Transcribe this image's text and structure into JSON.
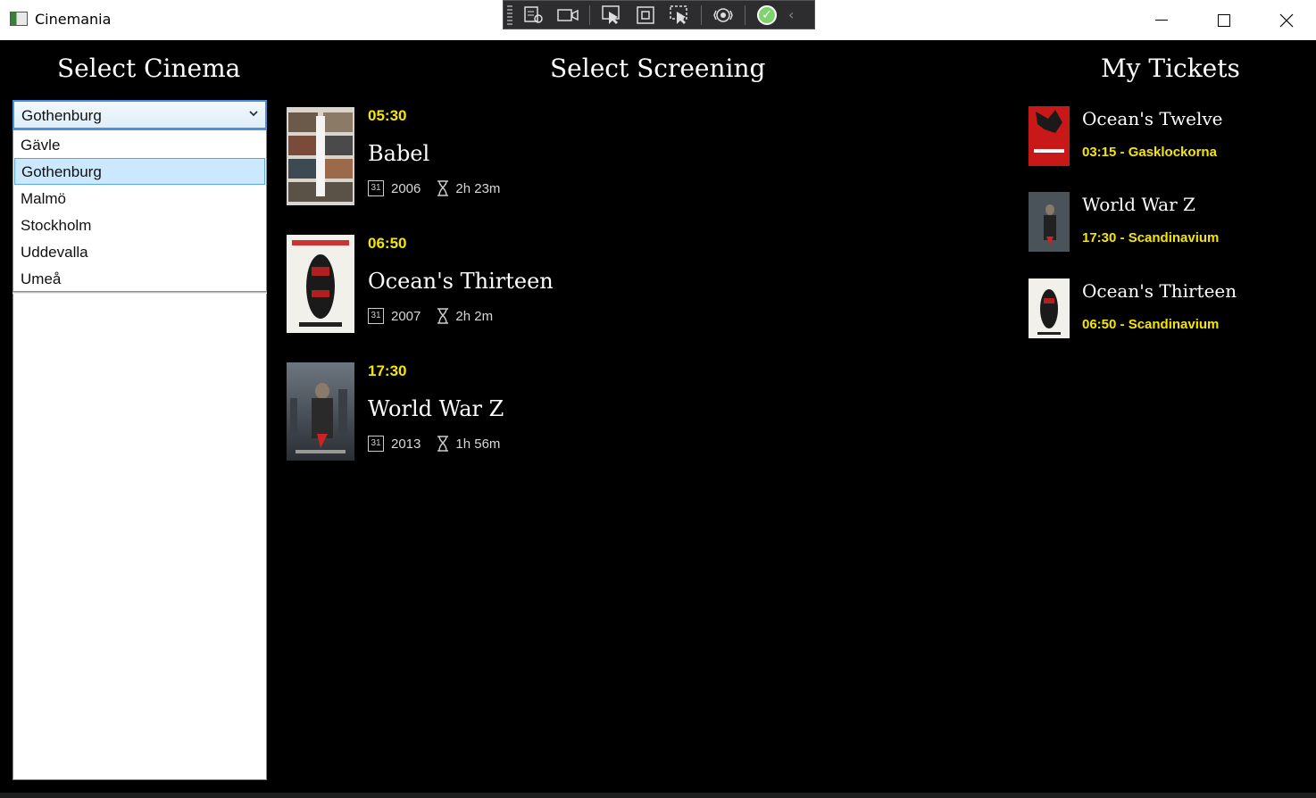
{
  "window": {
    "title": "Cinemania"
  },
  "headings": {
    "cinema": "Select Cinema",
    "screening": "Select Screening",
    "tickets": "My Tickets"
  },
  "cinema_select": {
    "selected": "Gothenburg",
    "options": [
      "Gävle",
      "Gothenburg",
      "Malmö",
      "Stockholm",
      "Uddevalla",
      "Umeå"
    ]
  },
  "screenings": [
    {
      "time": "05:30",
      "title": "Babel",
      "year": "2006",
      "duration": "2h 23m"
    },
    {
      "time": "06:50",
      "title": "Ocean's Thirteen",
      "year": "2007",
      "duration": "2h 2m"
    },
    {
      "time": "17:30",
      "title": "World War Z",
      "year": "2013",
      "duration": "1h 56m"
    }
  ],
  "tickets": [
    {
      "title": "Ocean's Twelve",
      "info": "03:15 - Gasklockorna"
    },
    {
      "title": "World War Z",
      "info": "17:30 - Scandinavium"
    },
    {
      "title": "Ocean's Thirteen",
      "info": "06:50 - Scandinavium"
    }
  ],
  "icons": {
    "calendar": "calendar-icon",
    "duration": "hourglass-icon"
  },
  "colors": {
    "accent_time": "#f5e600",
    "background": "#000000",
    "selection": "#cce8ff"
  }
}
